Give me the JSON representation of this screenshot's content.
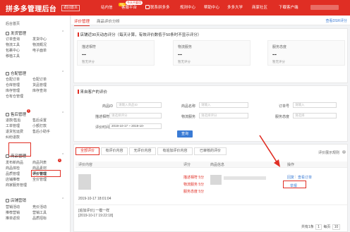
{
  "topbar": {
    "logo": "拼多多管理后台",
    "home": "返回首页",
    "nav": [
      "站内信",
      "客服平台",
      "联系拼多多",
      "规则中心",
      "帮助中心",
      "多多大学",
      "商家社区",
      "下载客户端"
    ],
    "bubble": "今天不要用"
  },
  "sidebar": {
    "top": "后台首页",
    "groups": [
      {
        "title": "发货管理",
        "items": [
          "订单查询",
          "发货中心",
          "物流工具",
          "物流概况",
          "包裹中心",
          "电子面单",
          "移植工具"
        ]
      },
      {
        "title": "仓配管理",
        "items": [
          "仓配订单",
          "仓配订单",
          "仓库管理",
          "货品管理",
          "库存管理",
          "库存查询",
          "仓有仓管理"
        ]
      },
      {
        "title": "售后管理",
        "items": [
          "退款/售后",
          "售后设置",
          "工单管理",
          "小额打款",
          "退货包运费",
          "售后小助手",
          "纠纷退款"
        ]
      },
      {
        "title": "商品管理",
        "items": [
          "发布新商品",
          "商品列表",
          "商品体检",
          "商品素材",
          "品质管理",
          "评价管理",
          "店铺推荐",
          "全价管理",
          "商家服务管理"
        ]
      },
      {
        "title": "店铺营销",
        "items": [
          "营销活动",
          "竞价活动",
          "推荐营销",
          "营销工具",
          "推单返现",
          "品质招标"
        ]
      }
    ]
  },
  "main": {
    "tabs": [
      "评价管理",
      "商品评价分析"
    ],
    "top_link": "查看DSR评分",
    "dsr": {
      "title": "店铺近90天动态评分（每天计算，有效评价数低于50条时不显示评分）",
      "stats": [
        {
          "label": "描述相符",
          "value": "--",
          "sub": "暂无评分"
        },
        {
          "label": "物流服务",
          "value": "--",
          "sub": "暂无评分"
        },
        {
          "label": "服务态度",
          "value": "--",
          "sub": "暂无评分"
        }
      ]
    },
    "filter": {
      "title": "来自客户的评价",
      "goods_id": {
        "label": "商品ID",
        "placeholder": "请输入商品ID"
      },
      "goods_name": {
        "label": "商品名称",
        "placeholder": "请输入"
      },
      "order_no": {
        "label": "订单号",
        "placeholder": "请输入"
      },
      "desc": {
        "label": "描述相符",
        "placeholder": "请选择评分"
      },
      "logistics": {
        "label": "物流服务",
        "placeholder": "请选择评分"
      },
      "service": {
        "label": "服务态度",
        "placeholder": "请选择"
      },
      "time": {
        "label": "评价时间",
        "value": "2019-10-17 ~ 2019-10-"
      },
      "query_btn": "查询"
    },
    "review_tabs": [
      "全部评价",
      "有评价内容",
      "无评价内容",
      "有追加评价内容",
      "已审核的评价"
    ],
    "review_hint": "评价展示规则",
    "table": {
      "headers": [
        "评价内容",
        "评分",
        "商品信息",
        "操作"
      ],
      "rows": [
        {
          "time": "2019-10-17 18:01:04",
          "scores": [
            "描述相符 5分",
            "物流服务 5分",
            "服务态度 5分"
          ],
          "actions": [
            "回复",
            "查看订单"
          ],
          "report": "举报"
        },
        {
          "content": "[追加评价] 一模一样",
          "time": "[2019-10-17 19:22:18]"
        }
      ]
    },
    "pager": {
      "total": "共有1条",
      "page": "1",
      "per": "每页",
      "size": "10"
    }
  }
}
